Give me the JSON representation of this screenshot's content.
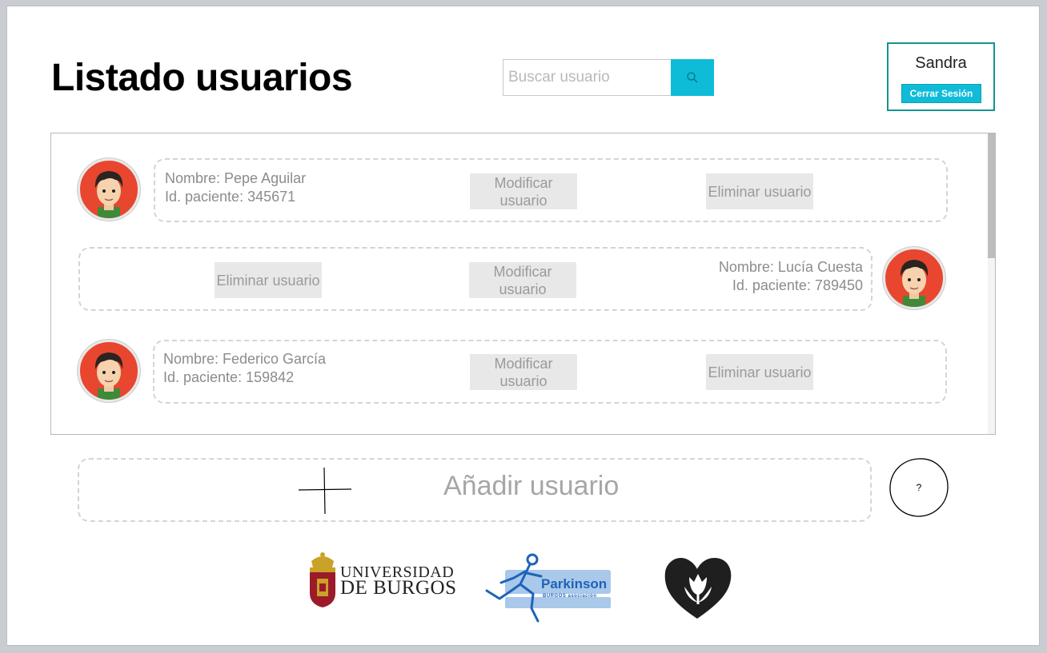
{
  "header": {
    "title": "Listado usuarios",
    "search_placeholder": "Buscar usuario",
    "search_icon": "search-icon"
  },
  "session": {
    "user_name": "Sandra",
    "logout_label": "Cerrar Sesión"
  },
  "users": [
    {
      "name": "Nombre: Pepe Aguilar",
      "id": "Id. paciente: 345671",
      "modify_label": "Modificar usuario",
      "delete_label": "Eliminar usuario",
      "avatar_icon": "avatar-icon"
    },
    {
      "name": "Nombre: Lucía Cuesta",
      "id": "Id. paciente: 789450",
      "modify_label": "Modificar usuario",
      "delete_label": "Eliminar usuario",
      "avatar_icon": "avatar-icon"
    },
    {
      "name": "Nombre: Federico García",
      "id": "Id. paciente: 159842",
      "modify_label": "Modificar usuario",
      "delete_label": "Eliminar usuario",
      "avatar_icon": "avatar-icon"
    }
  ],
  "add": {
    "label": "Añadir usuario",
    "icon": "plus-icon"
  },
  "help": {
    "label": "?"
  },
  "footer": {
    "university_line1": "UNIVERSIDAD",
    "university_line2": "DE BURGOS",
    "parkinson_name": "Parkinson",
    "parkinson_sub": "BURGOS asociación"
  },
  "colors": {
    "accent": "#0fbcd8",
    "session_border": "#16938e",
    "avatar_bg": "#e8462f"
  }
}
